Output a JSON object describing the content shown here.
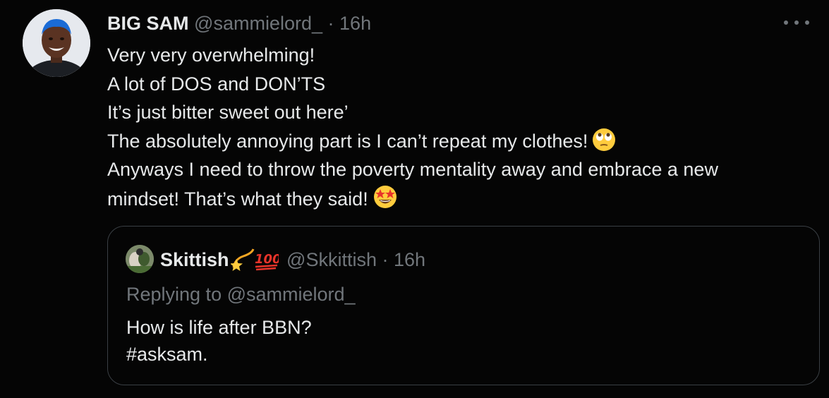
{
  "tweet": {
    "name": "BIG SAM",
    "handle": "@sammielord_",
    "separator": "·",
    "time": "16h",
    "lines": [
      "Very very overwhelming!",
      "A lot of DOS and DON’TS",
      "It’s just bitter sweet out here’",
      "The absolutely annoying part is I can’t repeat my clothes!",
      "Anyways I need to throw the poverty mentality away and embrace a new",
      "mindset! That’s what they said!"
    ],
    "emojis": [
      "face-with-rolling-eyes-emoji",
      "star-struck-emoji"
    ]
  },
  "quote": {
    "name": "Skittish",
    "name_emojis": [
      "dizzy-emoji",
      "hundred-points-emoji"
    ],
    "handle": "@Skkittish",
    "separator": "·",
    "time": "16h",
    "replying_prefix": "Replying to",
    "replying_handle": "@sammielord_",
    "lines": [
      "How is life after BBN?",
      "#asksam."
    ]
  },
  "colors": {
    "background": "#050505",
    "primary_text": "#e7e9ea",
    "secondary_text": "#71767b",
    "border": "#3a3f44"
  },
  "icons": [
    "more-options-icon"
  ]
}
